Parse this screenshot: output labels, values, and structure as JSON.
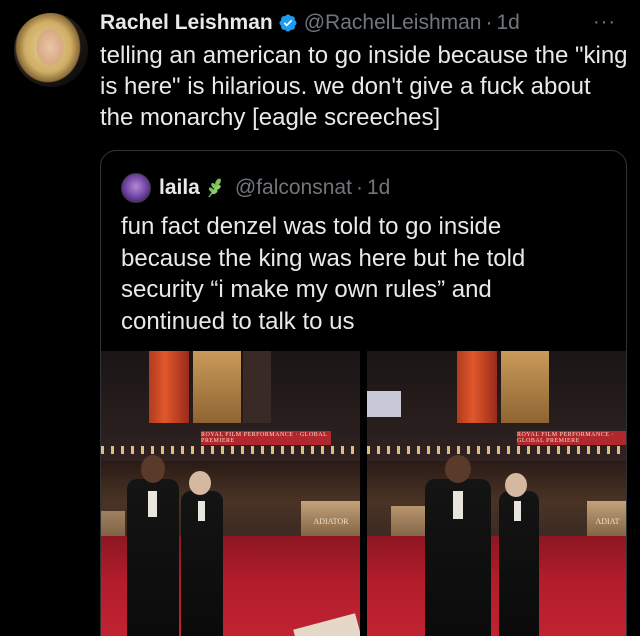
{
  "tweet": {
    "display_name": "Rachel Leishman",
    "handle": "@RachelLeishman",
    "separator": "·",
    "time": "1d",
    "more": "···",
    "text": "telling an american to go inside because the \"king is here\" is hilarious. we don't give a fuck about the monarchy [eagle screeches]"
  },
  "quote": {
    "display_name": "laila",
    "handle": "@falconsnat",
    "separator": "·",
    "time": "1d",
    "text": "fun fact denzel was told to go inside because the king was here but he told security “i make my own rules” and continued to talk to us"
  },
  "photos": [
    {
      "banner": "ROYAL FILM PERFORMANCE · GLOBAL PREMIERE",
      "sign": "ADIATOR"
    },
    {
      "banner": "ROYAL FILM PERFORMANCE · GLOBAL PREMIERE",
      "sign": "ADIAT"
    }
  ],
  "colors": {
    "background": "#000000",
    "text": "#e7e9ea",
    "secondary": "#71767b",
    "verified": "#1d9bf0",
    "border": "#2f3336"
  },
  "icons": [
    "verified-badge-icon",
    "more-icon",
    "leaf-emoji-icon"
  ]
}
